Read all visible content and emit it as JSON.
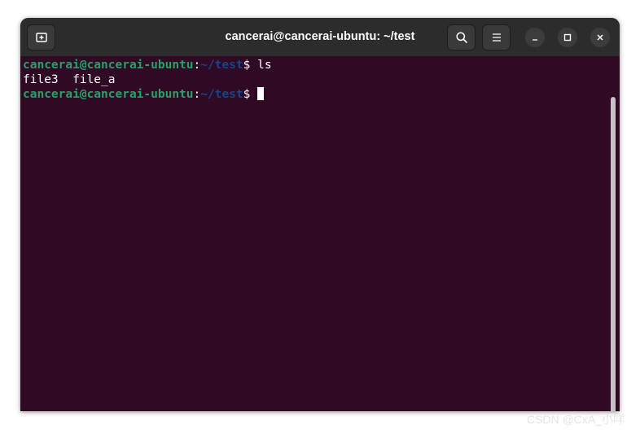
{
  "window": {
    "title": "cancerai@cancerai-ubuntu: ~/test"
  },
  "titlebar": {
    "new_tab_icon": "new-tab-icon",
    "search_icon": "search-icon",
    "menu_icon": "hamburger-menu-icon",
    "minimize_icon": "minimize-icon",
    "maximize_icon": "maximize-icon",
    "close_icon": "close-icon"
  },
  "terminal": {
    "lines": [
      {
        "user_host": "cancerai@cancerai-ubuntu",
        "colon": ":",
        "path": "~/test",
        "prompt": "$ ",
        "command": "ls"
      },
      {
        "output": "file3  file_a"
      },
      {
        "user_host": "cancerai@cancerai-ubuntu",
        "colon": ":",
        "path": "~/test",
        "prompt": "$ ",
        "command": ""
      }
    ]
  },
  "colors": {
    "terminal_background": "#300a24",
    "titlebar_background": "#2c2c2c",
    "prompt_user": "#26a269",
    "prompt_path": "#12488b",
    "text": "#ffffff"
  },
  "watermark": {
    "text": "CSDN @CxA_小咩"
  }
}
